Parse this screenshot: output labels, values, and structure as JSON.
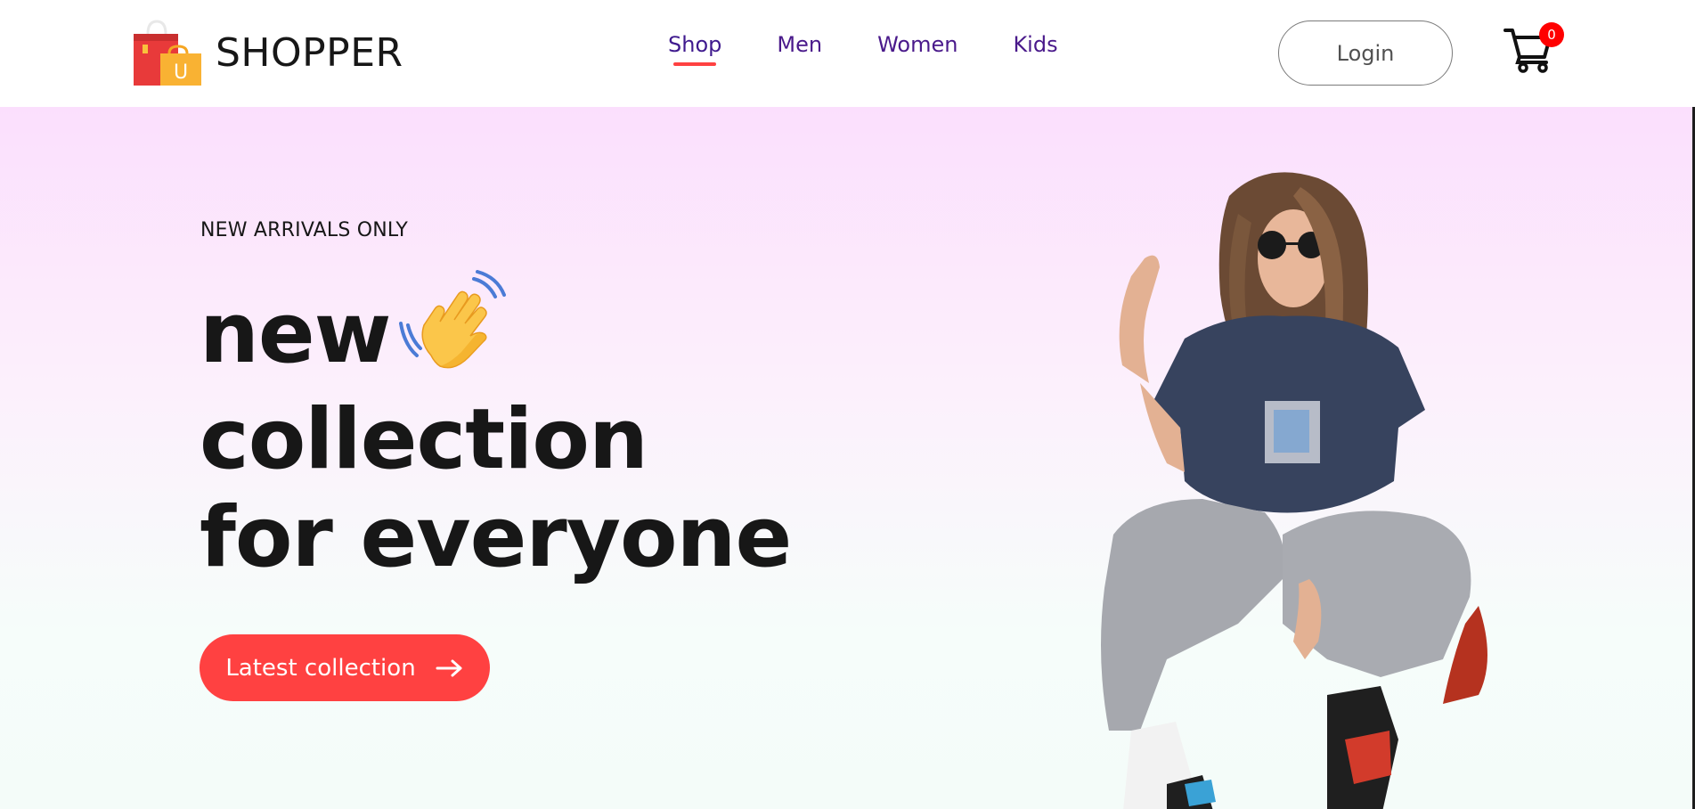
{
  "brand": {
    "name": "SHOPPER",
    "logo_icon": "shopping-bag-icon",
    "logo_letter": "U"
  },
  "nav": {
    "items": [
      {
        "label": "Shop",
        "active": true
      },
      {
        "label": "Men",
        "active": false
      },
      {
        "label": "Women",
        "active": false
      },
      {
        "label": "Kids",
        "active": false
      }
    ]
  },
  "header": {
    "login_label": "Login",
    "cart_icon": "cart-icon",
    "cart_count": "0"
  },
  "hero": {
    "tagline": "NEW ARRIVALS ONLY",
    "line1": "new",
    "line2": "collection",
    "line3": "for everyone",
    "wave_icon": "waving-hand-icon",
    "cta_label": "Latest collection",
    "cta_icon": "arrow-right-icon",
    "image": "hero-model-image"
  },
  "colors": {
    "accent": "#ff4141",
    "nav_text": "#4a1a8b",
    "hero_top": "#fbdffd",
    "hero_bottom": "#f4fcf9",
    "badge": "#ff0000"
  }
}
